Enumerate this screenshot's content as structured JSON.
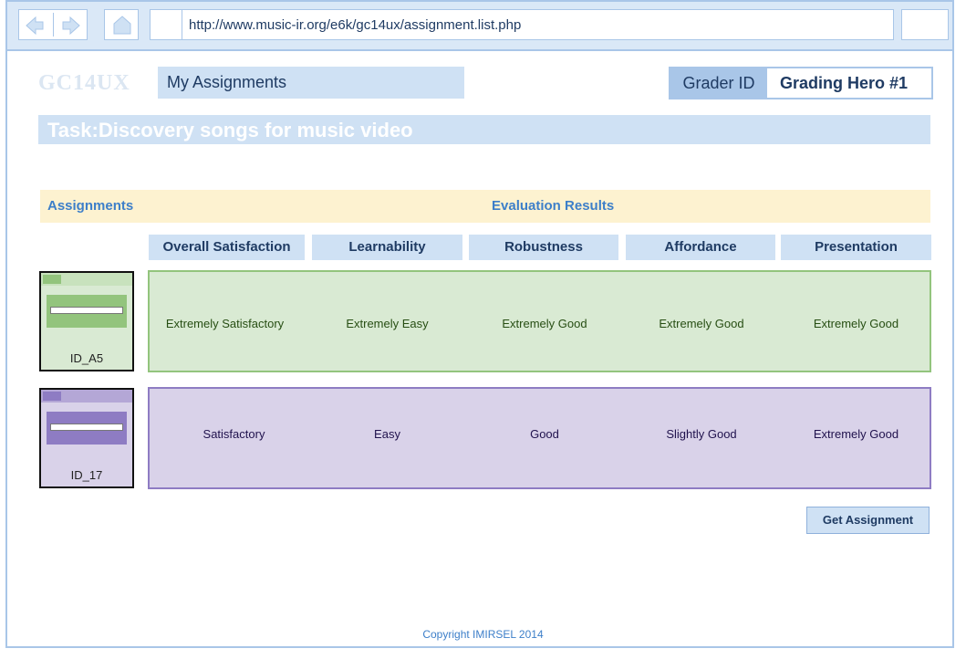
{
  "browser": {
    "url": "http://www.music-ir.org/e6k/gc14ux/assignment.list.php",
    "icons": [
      "back-arrow-icon",
      "forward-arrow-icon",
      "home-icon"
    ]
  },
  "header": {
    "logo": "GC14UX",
    "page_title": "My Assignments",
    "grader_label": "Grader ID",
    "grader_value": "Grading Hero #1",
    "task": "Task:Discovery songs for music video"
  },
  "table": {
    "assignments_heading": "Assignments",
    "results_heading": "Evaluation Results",
    "columns": [
      "Overall Satisfaction",
      "Learnability",
      "Robustness",
      "Affordance",
      "Presentation"
    ],
    "rows": [
      {
        "id": "ID_A5",
        "values": [
          "Extremely Satisfactory",
          "Extremely Easy",
          "Extremely Good",
          "Extremely Good",
          "Extremely Good"
        ],
        "colors": {
          "bg": "#d9ead3",
          "border": "#93c47d",
          "text": "#274e13",
          "thumb_top": "#c8e2bd",
          "thumb_fav": "#93c47d",
          "thumb_box": "#93c47d"
        }
      },
      {
        "id": "ID_17",
        "values": [
          "Satisfactory",
          "Easy",
          "Good",
          "Slightly Good",
          "Extremely Good"
        ],
        "colors": {
          "bg": "#d9d2e9",
          "border": "#8e7cc3",
          "text": "#20124d",
          "thumb_top": "#b4a7d6",
          "thumb_fav": "#8e7cc3",
          "thumb_box": "#8e7cc3"
        }
      }
    ]
  },
  "actions": {
    "get_assignment": "Get Assignment"
  },
  "footer": {
    "copyright": "Copyright IMIRSEL 2014"
  },
  "colors": {
    "accent": "#a9c6e8",
    "light_accent": "#cfe1f4",
    "header_band": "#fdf2d0",
    "link_blue": "#3d7fc9"
  }
}
